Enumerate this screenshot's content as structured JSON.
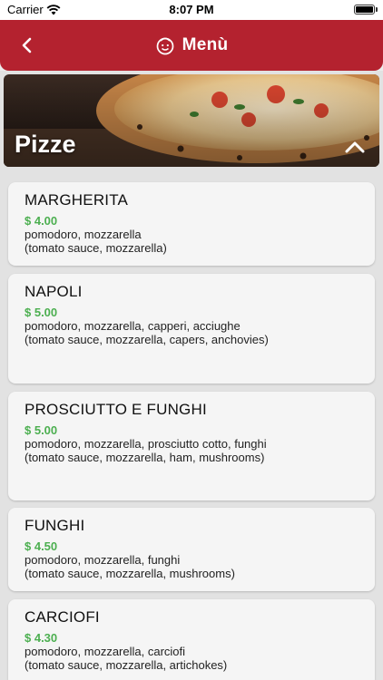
{
  "status_bar": {
    "carrier": "Carrier",
    "time": "8:07 PM"
  },
  "nav": {
    "title": "Menù",
    "back_icon": "chevron-left-icon",
    "logo_icon": "chef-logo-icon"
  },
  "category": {
    "title": "Pizze",
    "expanded": true,
    "toggle_icon": "chevron-up-icon"
  },
  "items": [
    {
      "name": "MARGHERITA",
      "price": "$ 4.00",
      "desc_it": "pomodoro, mozzarella",
      "desc_en": "(tomato sauce, mozzarella)"
    },
    {
      "name": "NAPOLI",
      "price": "$ 5.00",
      "desc_it": "pomodoro, mozzarella, capperi, acciughe",
      "desc_en": "(tomato sauce, mozzarella, capers, anchovies)"
    },
    {
      "name": "PROSCIUTTO E FUNGHI",
      "price": "$ 5.00",
      "desc_it": "pomodoro, mozzarella, prosciutto cotto, funghi",
      "desc_en": "(tomato sauce, mozzarella, ham, mushrooms)"
    },
    {
      "name": "FUNGHI",
      "price": "$ 4.50",
      "desc_it": "pomodoro, mozzarella, funghi",
      "desc_en": "(tomato sauce, mozzarella, mushrooms)"
    },
    {
      "name": "CARCIOFI",
      "price": "$ 4.30",
      "desc_it": "pomodoro, mozzarella, carciofi",
      "desc_en": "(tomato sauce, mozzarella, artichokes)"
    }
  ],
  "colors": {
    "brand": "#b4222f",
    "price": "#4caf50",
    "card": "#f5f5f5",
    "background": "#e2e2e2"
  }
}
